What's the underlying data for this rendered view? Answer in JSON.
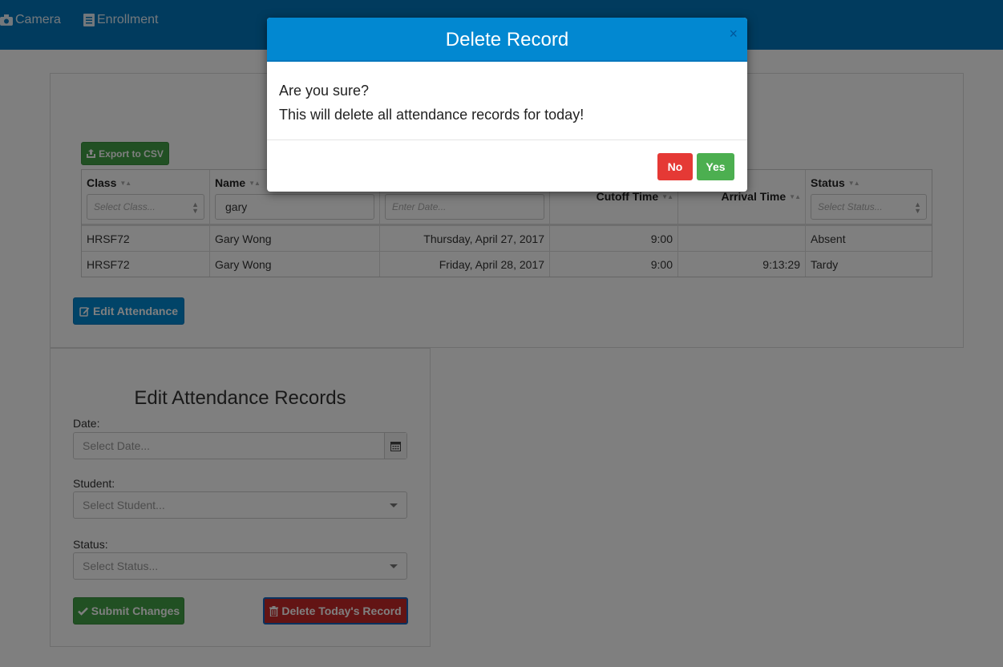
{
  "nav": {
    "camera": "Camera",
    "enrollment": "Enrollment"
  },
  "toolbar": {
    "export_csv": "Export to CSV",
    "edit_attendance": "Edit Attendance"
  },
  "grid": {
    "columns": {
      "class": {
        "label": "Class",
        "filter_placeholder": "Select Class..."
      },
      "name": {
        "label": "Name",
        "filter_value": "gary"
      },
      "date": {
        "filter_placeholder": "Enter Date..."
      },
      "cutoff": {
        "label": "Cutoff Time"
      },
      "arrival": {
        "label": "Arrival Time"
      },
      "status": {
        "label": "Status",
        "filter_placeholder": "Select Status..."
      }
    },
    "rows": [
      {
        "class": "HRSF72",
        "name": "Gary Wong",
        "date": "Thursday, April 27, 2017",
        "cutoff": "9:00",
        "arrival": "",
        "status": "Absent"
      },
      {
        "class": "HRSF72",
        "name": "Gary Wong",
        "date": "Friday, April 28, 2017",
        "cutoff": "9:00",
        "arrival": "9:13:29",
        "status": "Tardy"
      }
    ]
  },
  "edit_form": {
    "title": "Edit Attendance Records",
    "date_label": "Date:",
    "date_placeholder": "Select Date...",
    "student_label": "Student:",
    "student_placeholder": "Select Student...",
    "status_label": "Status:",
    "status_placeholder": "Select Status...",
    "submit_label": "Submit Changes",
    "delete_label": "Delete Today's Record"
  },
  "modal": {
    "title": "Delete Record",
    "close": "×",
    "line1": "Are you sure?",
    "line2": "This will delete all attendance records for today!",
    "no_label": "No",
    "yes_label": "Yes"
  },
  "colors": {
    "primary": "#0288d1",
    "success": "#4caf50",
    "danger": "#e53935"
  },
  "icons": {
    "camera": "camera-icon",
    "enrollment": "list-icon",
    "export": "export-icon",
    "edit": "edit-icon",
    "calendar": "calendar-icon",
    "check": "check-icon",
    "trash": "trash-icon"
  }
}
